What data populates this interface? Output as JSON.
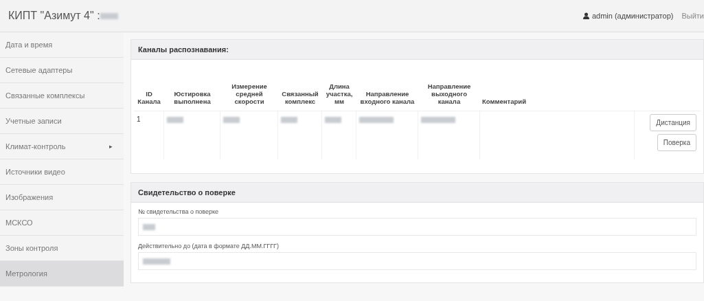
{
  "header": {
    "title": "КИПТ \"Азимут 4\" :",
    "title_redacted": true,
    "user": "admin (администратор)",
    "logout": "Выйти"
  },
  "sidebar": {
    "items": [
      {
        "label": "Дата и время",
        "selected": false
      },
      {
        "label": "Сетевые адаптеры",
        "selected": false
      },
      {
        "label": "Связанные комплексы",
        "selected": false
      },
      {
        "label": "Учетные записи",
        "selected": false
      },
      {
        "label": "Климат-контроль",
        "selected": false,
        "arrow": "▸"
      },
      {
        "label": "Источники видео",
        "selected": false
      },
      {
        "label": "Изображения",
        "selected": false
      },
      {
        "label": "МСКСО",
        "selected": false
      },
      {
        "label": "Зоны контроля",
        "selected": false
      },
      {
        "label": "Метрология",
        "selected": true
      }
    ]
  },
  "channels_panel": {
    "title": "Каналы распознавания:",
    "columns": [
      "ID Канала",
      "Юстировка выполнена",
      "Измерение средней скорости",
      "Связанный комплекс",
      "Длина участка, мм",
      "Направление входного канала",
      "Направление выходного канала",
      "Комментарий"
    ],
    "rows": [
      {
        "cells": [
          {
            "kind": "text",
            "text": "1"
          },
          {
            "kind": "redacted"
          },
          {
            "kind": "redacted"
          },
          {
            "kind": "redacted"
          },
          {
            "kind": "redacted"
          },
          {
            "kind": "redacted"
          },
          {
            "kind": "redacted"
          },
          {
            "kind": "empty"
          }
        ],
        "buttons": [
          "Дистанция",
          "Поверка"
        ]
      }
    ]
  },
  "certificate_panel": {
    "title": "Свидетельство о поверке",
    "fields": [
      {
        "label": "№ свидетельства о поверке",
        "redacted": true
      },
      {
        "label": "Действительно до (дата в формате ДД.ММ.ГГГГ)",
        "redacted": true
      }
    ]
  }
}
